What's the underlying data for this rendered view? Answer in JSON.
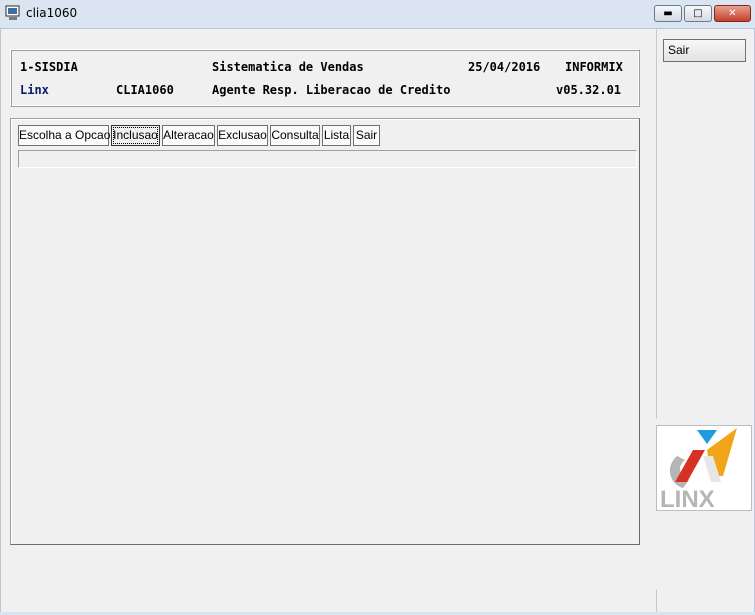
{
  "window": {
    "title": "clia1060",
    "min_icon": "minimize-icon",
    "max_icon": "maximize-icon",
    "close_icon": "close-icon"
  },
  "header": {
    "system": "1-SISDIA",
    "module_title": "Sistematica de Vendas",
    "date": "25/04/2016",
    "db": "INFORMIX",
    "company": "Linx",
    "program": "CLIA1060",
    "screen_title": "Agente Resp. Liberacao de Credito",
    "version": "v05.32.01"
  },
  "menu": {
    "items": [
      {
        "label": "Escolha a Opcao"
      },
      {
        "label": "Inclusao",
        "selected": true
      },
      {
        "label": "Alteracao"
      },
      {
        "label": "Exclusao"
      },
      {
        "label": "Consulta"
      },
      {
        "label": "Lista"
      },
      {
        "label": "Sair"
      }
    ]
  },
  "message_bar": {
    "text": ""
  },
  "sidebar": {
    "exit_label": "Sair",
    "logo_text": "LINX"
  },
  "colors": {
    "titlebar": "#dbe5f1",
    "close_button": "#c4402a",
    "logo_blue": "#1e9be3",
    "logo_orange": "#f2a51a",
    "logo_grey": "#b5b5b5",
    "header_blue_text": "#0b1a6b"
  }
}
